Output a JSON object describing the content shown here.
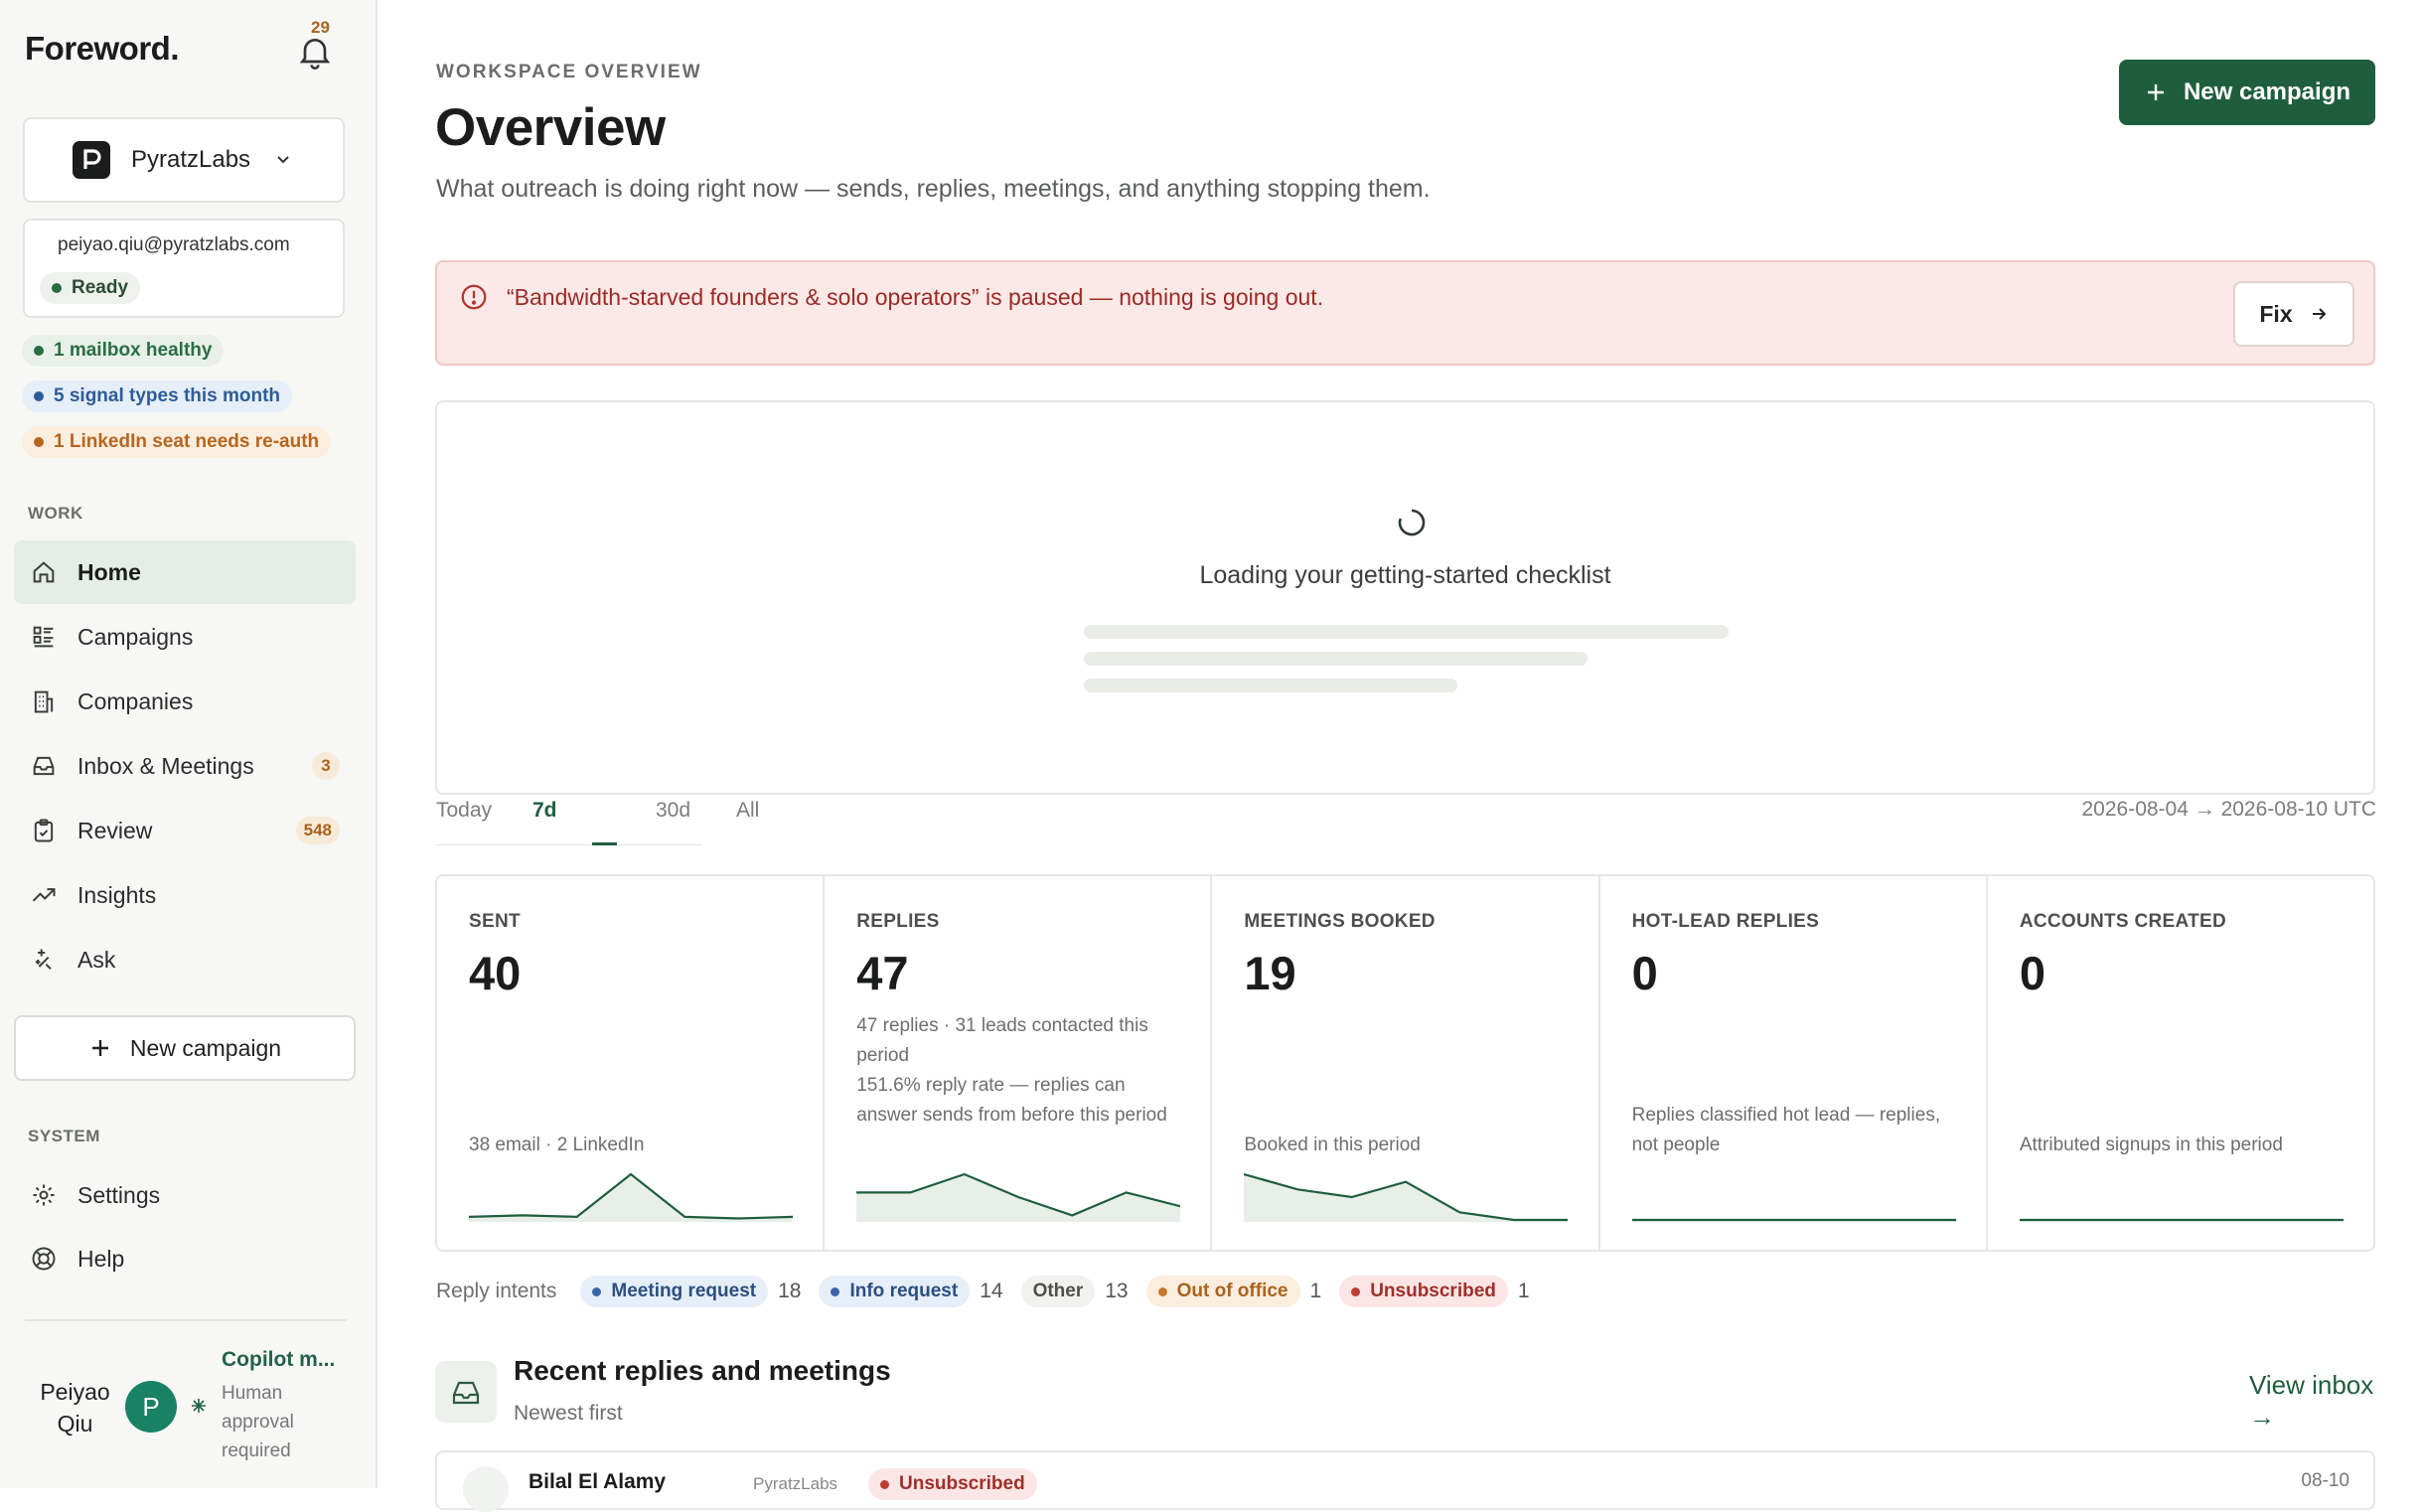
{
  "brand": "Foreword.",
  "notifications": {
    "count": "29"
  },
  "workspace": {
    "name": "PyratzLabs"
  },
  "account": {
    "email": "peiyao.qiu@pyratzlabs.com",
    "status": "Ready"
  },
  "health_chips": [
    {
      "label": "1 mailbox healthy",
      "color": "#2a6e45"
    },
    {
      "label": "5 signal types this month",
      "color": "#2e5d96"
    },
    {
      "label": "1 LinkedIn seat needs re-auth",
      "color": "#b5661f"
    }
  ],
  "sidebar": {
    "work_heading": "WORK",
    "items": [
      {
        "label": "Home",
        "icon": "home-icon"
      },
      {
        "label": "Campaigns",
        "icon": "campaigns-icon"
      },
      {
        "label": "Companies",
        "icon": "building-icon"
      },
      {
        "label": "Inbox & Meetings",
        "icon": "inbox-icon",
        "count": "3"
      },
      {
        "label": "Review",
        "icon": "clipboard-icon",
        "count": "548"
      },
      {
        "label": "Insights",
        "icon": "trend-icon"
      },
      {
        "label": "Ask",
        "icon": "sparkle-icon"
      }
    ],
    "new_campaign": "New campaign",
    "system_heading": "SYSTEM",
    "system_items": [
      {
        "label": "Settings",
        "icon": "gear-icon"
      },
      {
        "label": "Help",
        "icon": "lifebuoy-icon"
      }
    ]
  },
  "user": {
    "name": "Peiyao Qiu",
    "initial": "P",
    "copilot_title": "Copilot m...",
    "copilot_status": "Human approval required"
  },
  "header": {
    "eyebrow": "WORKSPACE OVERVIEW",
    "title": "Overview",
    "subtitle": "What outreach is doing right now — sends, replies, meetings, and anything stopping them.",
    "new_campaign": "New campaign"
  },
  "alert": {
    "text": "“Bandwidth-starved founders & solo operators” is paused — nothing is going out.",
    "action": "Fix"
  },
  "checklist": {
    "loading_text": "Loading your getting-started checklist"
  },
  "period_tabs": [
    "Today",
    "7d",
    "30d",
    "All"
  ],
  "period_active": "7d",
  "date_range": "2026-08-04 → 2026-08-10 UTC",
  "metrics": [
    {
      "label": "SENT",
      "value": "40",
      "note": "",
      "foot": "38 email · 2 LinkedIn",
      "spark": [
        2,
        3,
        2,
        30,
        2,
        1,
        2
      ]
    },
    {
      "label": "REPLIES",
      "value": "47",
      "note": "47 replies · 31 leads contacted this period",
      "foot": "151.6% reply rate — replies can answer sends from before this period",
      "spark": [
        6,
        6,
        10,
        5,
        1,
        6,
        3
      ]
    },
    {
      "label": "MEETINGS BOOKED",
      "value": "19",
      "note": "",
      "foot": "Booked in this period",
      "spark": [
        6,
        4,
        3,
        5,
        1,
        0,
        0
      ]
    },
    {
      "label": "HOT-LEAD REPLIES",
      "value": "0",
      "note": "",
      "foot": "Replies classified hot lead — replies, not people",
      "spark": [
        0,
        0,
        0,
        0,
        0,
        0,
        0
      ]
    },
    {
      "label": "ACCOUNTS CREATED",
      "value": "0",
      "note": "",
      "foot": "Attributed signups in this period",
      "spark": [
        0,
        0,
        0,
        0,
        0,
        0,
        0
      ]
    }
  ],
  "reply_intents": {
    "label": "Reply intents",
    "items": [
      {
        "label": "Meeting request",
        "count": "18",
        "bg": "#e6eef8",
        "fg": "#2c4f80",
        "dot": "#3a66a8"
      },
      {
        "label": "Info request",
        "count": "14",
        "bg": "#e6eef8",
        "fg": "#2c4f80",
        "dot": "#3a66a8"
      },
      {
        "label": "Other",
        "count": "13",
        "bg": "#f1f2ef",
        "fg": "#4d504d",
        "dot": ""
      },
      {
        "label": "Out of office",
        "count": "1",
        "bg": "#fbeedf",
        "fg": "#a9631e",
        "dot": "#c7782c"
      },
      {
        "label": "Unsubscribed",
        "count": "1",
        "bg": "#fbe6e5",
        "fg": "#a0302a",
        "dot": "#bd3d35"
      }
    ]
  },
  "recent": {
    "title": "Recent replies and meetings",
    "subtitle": "Newest first",
    "view_all": "View inbox →",
    "rows": [
      {
        "name": "Bilal El Alamy",
        "company": "PyratzLabs",
        "tag": "Unsubscribed",
        "date": "08-10"
      }
    ]
  },
  "colors": {
    "accent": "#1f5e3d",
    "alert_bg": "#fbe9e8",
    "alert_text": "#9c2a24"
  }
}
